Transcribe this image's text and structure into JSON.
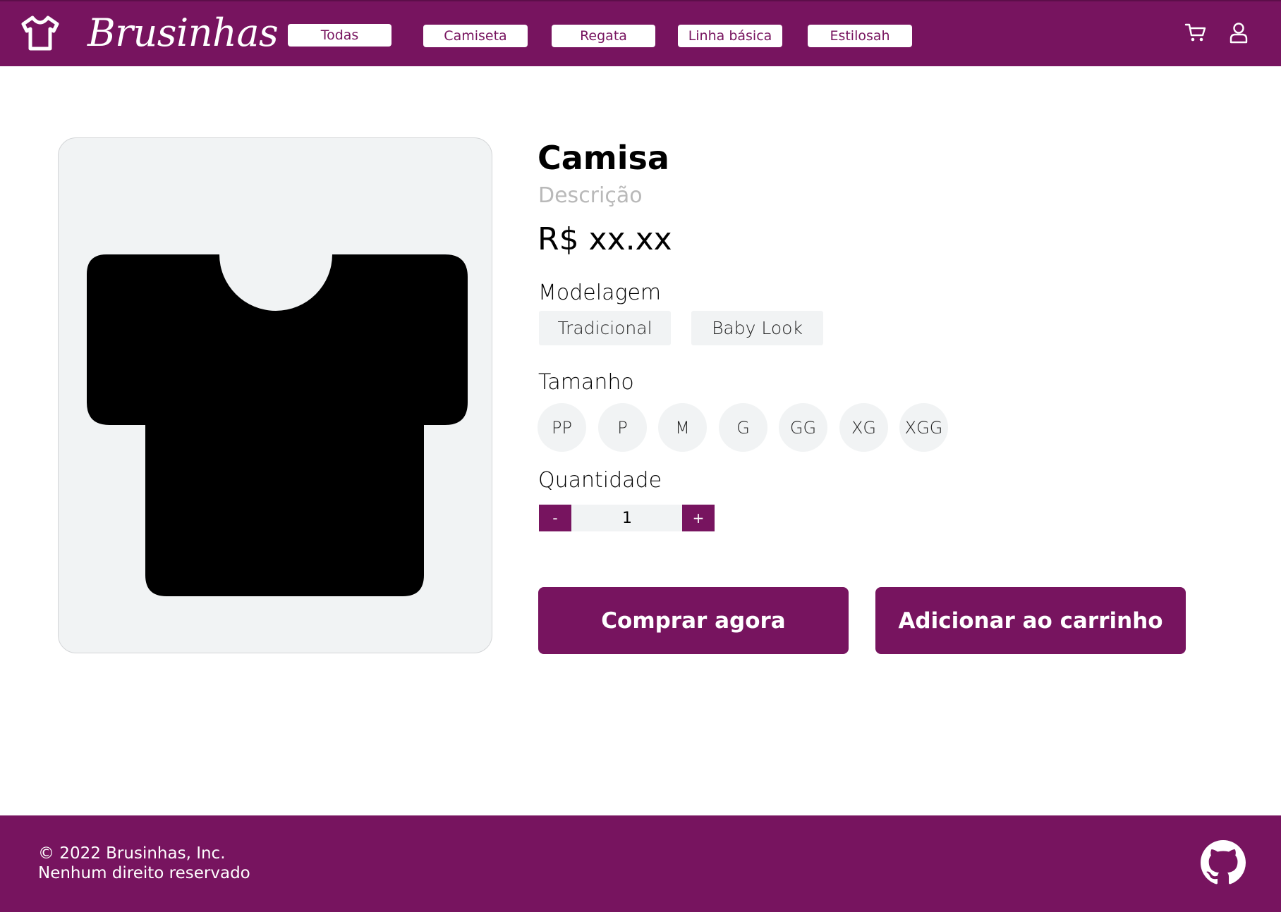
{
  "header": {
    "brand": "Brusinhas",
    "logo_icon": "tshirt-icon",
    "nav": [
      "Todas",
      "Camiseta",
      "Regata",
      "Linha básica",
      "Estilosah"
    ],
    "cart_icon": "cart-icon",
    "user_icon": "user-icon",
    "accent_color": "#77145f"
  },
  "product": {
    "title": "Camisa",
    "description": "Descrição",
    "price": "R$ xx.xx",
    "image_icon": "tshirt-icon",
    "model_label": "Modelagem",
    "models": [
      "Tradicional",
      "Baby Look"
    ],
    "size_label": "Tamanho",
    "sizes": [
      "PP",
      "P",
      "M",
      "G",
      "GG",
      "XG",
      "XGG"
    ],
    "quantity_label": "Quantidade",
    "quantity": "1",
    "decrement": "-",
    "increment": "+",
    "buy_now": "Comprar agora",
    "add_to_cart": "Adicionar ao carrinho"
  },
  "footer": {
    "copyright": "© 2022 Brusinhas, Inc.",
    "rights": "Nenhum direito reservado",
    "github_icon": "github-icon"
  }
}
